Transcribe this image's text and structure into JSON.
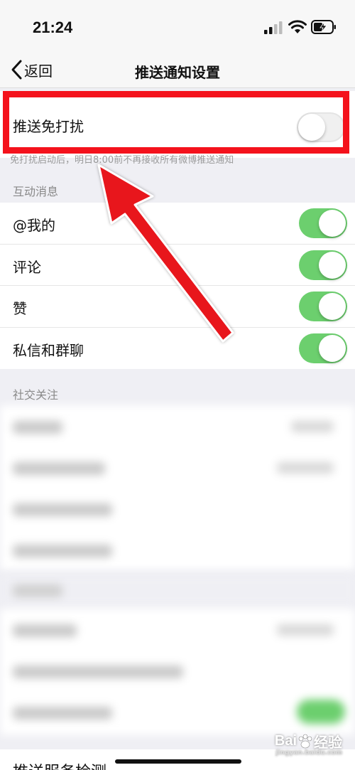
{
  "status_bar": {
    "time": "21:24"
  },
  "nav": {
    "back_label": "返回",
    "title": "推送通知设置"
  },
  "dnd": {
    "label": "推送免打扰",
    "enabled": false,
    "description": "免打扰启动后，明日8:00前不再接收所有微博推送通知"
  },
  "interaction": {
    "header": "互动消息",
    "items": [
      {
        "label": "@我的",
        "enabled": true
      },
      {
        "label": "评论",
        "enabled": true
      },
      {
        "label": "赞",
        "enabled": true
      },
      {
        "label": "私信和群聊",
        "enabled": true
      }
    ]
  },
  "social": {
    "header": "社交关注"
  },
  "bottom": {
    "label": "推送服务检测"
  },
  "watermark": {
    "brand": "Bai",
    "brand2": "经验",
    "url": "jingyan.baidu.com"
  },
  "colors": {
    "highlight": "#f4121c",
    "toggle_on": "#6ccf6e",
    "arrow": "#e8121b"
  },
  "icons": [
    "back-chevron-icon",
    "signal-icon",
    "wifi-icon",
    "battery-charging-icon",
    "annotation-arrow-icon",
    "baidu-paw-icon"
  ]
}
